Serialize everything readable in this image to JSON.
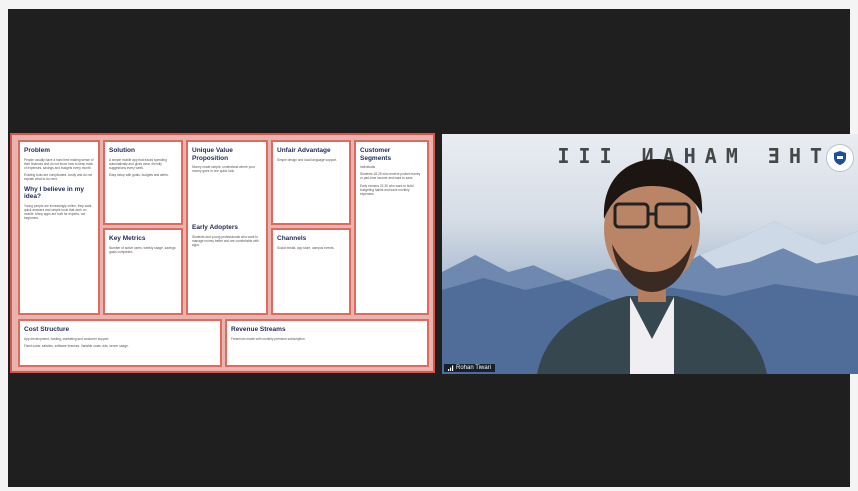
{
  "canvas": {
    "cells": {
      "problem": {
        "title": "Problem",
        "body1": "People usually have a hard time making sense of their finances and do not know how to keep track of expenses, savings and budgets every month.",
        "body2": "Existing tools are complicated, costly and do not explain what to do next.",
        "subtitle": "Why I believe in my idea?",
        "body3": "Young people are increasingly online, they want quick answers and simple tools that work on mobile. Many apps are built for experts, not beginners."
      },
      "solution": {
        "title": "Solution",
        "body1": "A simple mobile app that tracks spending automatically and gives clear, friendly suggestions every week.",
        "body2": "Easy setup with goals, budgets and alerts."
      },
      "uvp": {
        "title": "Unique Value Proposition",
        "body1": "Money made simple: understand where your money goes in one quick look.",
        "subtitle": "Early Adopters",
        "body2": "Students and young professionals who want to manage money better and are comfortable with apps."
      },
      "unfair": {
        "title": "Unfair Advantage",
        "body1": "Simple design and local language support."
      },
      "segments": {
        "title": "Customer Segments",
        "body1": "Individuals",
        "body2": "Students 18-25 who receive pocket money or part-time income and want to save.",
        "body3": "Early earners 22-30 who want to build budgeting habits and track monthly expenses."
      },
      "metrics": {
        "title": "Key Metrics",
        "body1": "Number of active users, weekly usage, savings goals completed."
      },
      "channels": {
        "title": "Channels",
        "body1": "Social media, app store, campus events."
      },
      "cost": {
        "title": "Cost Structure",
        "body1": "App development, hosting, marketing and customer support.",
        "body2": "Fixed costs: salaries, software licenses. Variable costs: ads, server usage."
      },
      "revenue": {
        "title": "Revenue Streams",
        "body1": "Freemium model with monthly premium subscription."
      }
    }
  },
  "video": {
    "wall_text": "THE MAHAN III",
    "participant_name": "Rohan Tiwari",
    "signal_icon": "signal-bars-icon",
    "badge_icon": "shield-logo-icon"
  }
}
